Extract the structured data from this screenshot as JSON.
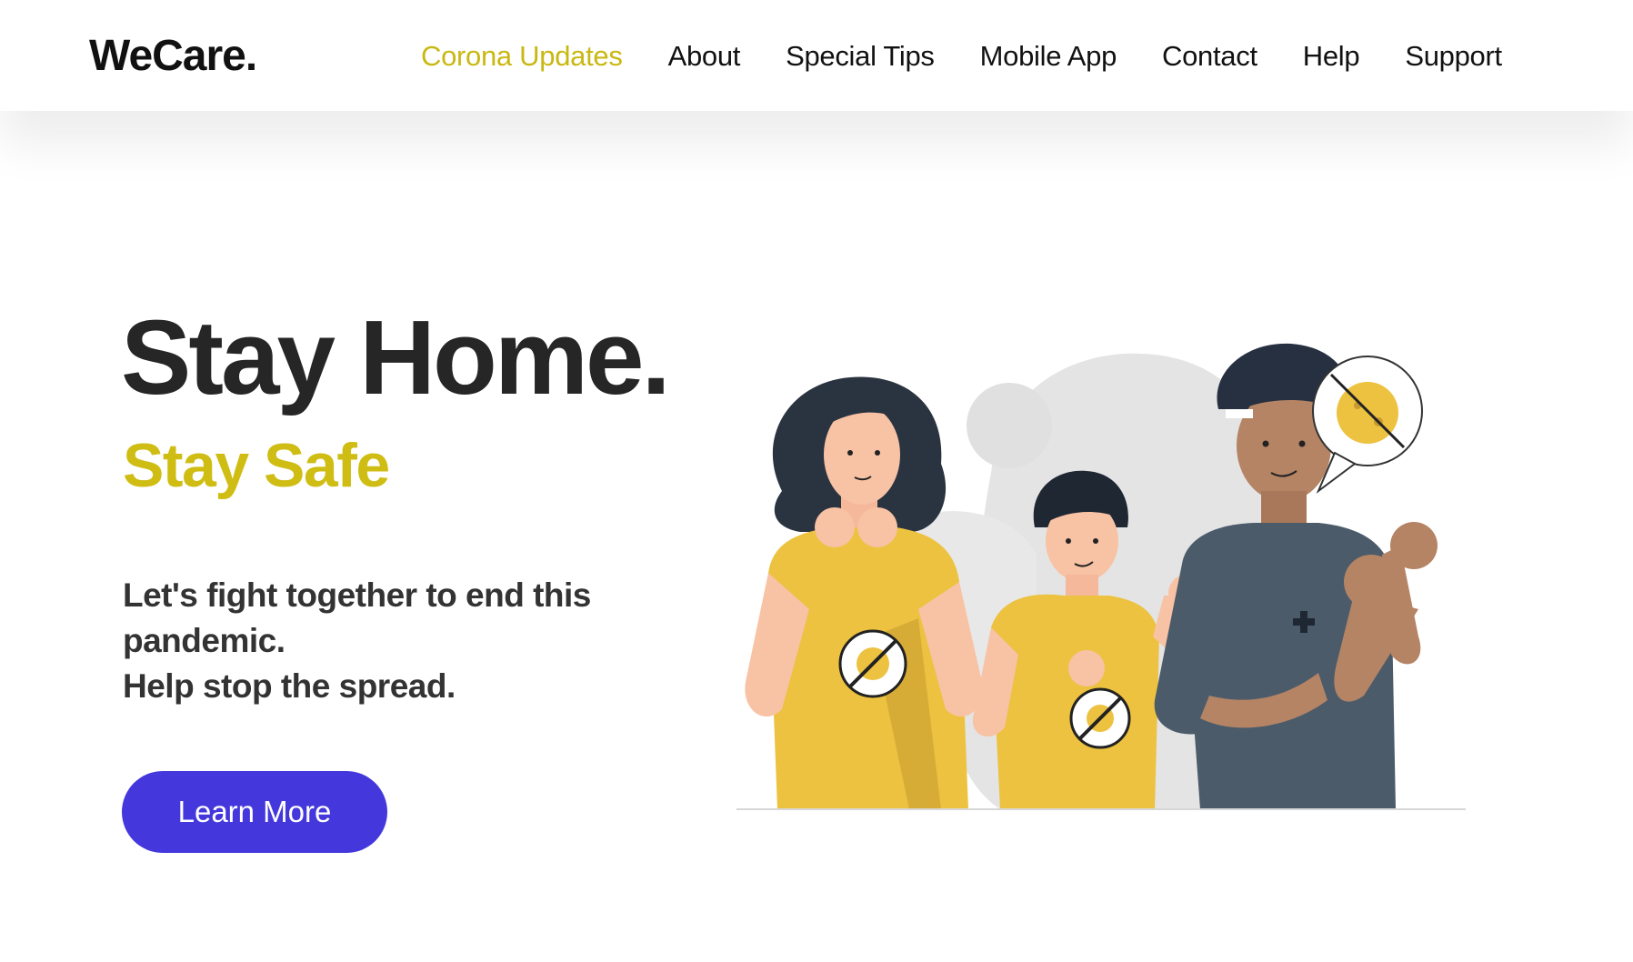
{
  "header": {
    "brand": "WeCare.",
    "nav": [
      {
        "label": "Corona Updates",
        "active": true
      },
      {
        "label": "About",
        "active": false
      },
      {
        "label": "Special Tips",
        "active": false
      },
      {
        "label": "Mobile App",
        "active": false
      },
      {
        "label": "Contact",
        "active": false
      },
      {
        "label": "Help",
        "active": false
      },
      {
        "label": "Support",
        "active": false
      }
    ]
  },
  "hero": {
    "title": "Stay Home.",
    "subtitle": "Stay Safe",
    "description_lines": [
      "Let's fight together to end this",
      "pandemic.",
      "Help stop the spread."
    ],
    "cta_label": "Learn More"
  },
  "illustration": {
    "subject": "family-fighting-virus-illustration",
    "icons": [
      "no-virus-icon",
      "speech-bubble-icon",
      "medical-cross-icon"
    ]
  },
  "colors": {
    "accent_yellow": "#cfbd14",
    "button_blue": "#4438dd",
    "text_dark": "#262626"
  }
}
